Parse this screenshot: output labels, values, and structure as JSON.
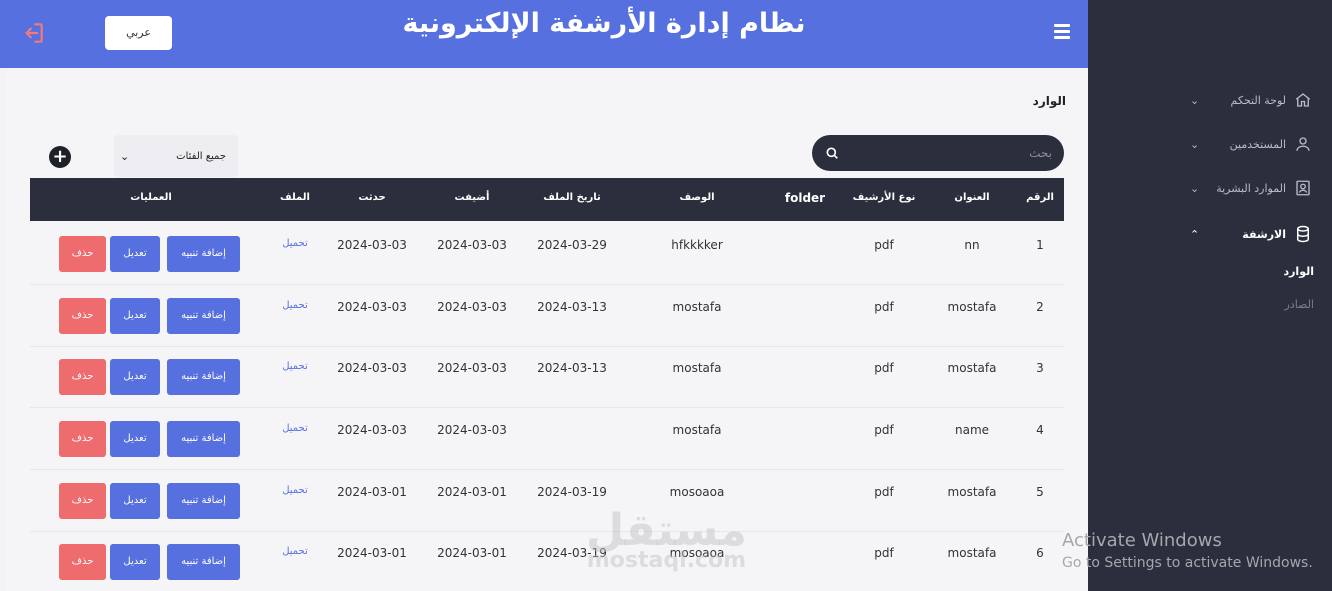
{
  "header": {
    "title": "نظام إدارة الأرشفة الإلكترونية",
    "lang_label": "عربي",
    "logout_icon": "logout-icon",
    "menu_icon": "hamburger-icon",
    "color": "#5670e0"
  },
  "sidebar": {
    "items": [
      {
        "label": "لوحة التحكم",
        "icon": "home-icon"
      },
      {
        "label": "المستخدمين",
        "icon": "user-icon"
      },
      {
        "label": "الموارد البشرية",
        "icon": "id-card-icon"
      },
      {
        "label": "الارشفة",
        "icon": "database-icon"
      }
    ],
    "subitems": [
      {
        "label": "الوارد"
      },
      {
        "label": "الصادر"
      }
    ],
    "bg_color": "#2b2e3c"
  },
  "main": {
    "page_title": "الوارد",
    "search_placeholder": "بحث",
    "category_select": "جميع الفئات",
    "add_icon": "plus-circle-icon"
  },
  "table": {
    "headers": [
      "الرقم",
      "العنوان",
      "نوع الأرشيف",
      "folder",
      "الوصف",
      "تاريخ الملف",
      "أضيفت",
      "حدثت",
      "الملف",
      "العمليات"
    ],
    "rows": [
      {
        "num": "1",
        "title": "nn",
        "type": "pdf",
        "folder": "",
        "desc": "hfkkkker",
        "file_date": "2024-03-29",
        "added": "2024-03-03",
        "updated": "2024-03-03",
        "file": "تحميل"
      },
      {
        "num": "2",
        "title": "mostafa",
        "type": "pdf",
        "folder": "",
        "desc": "mostafa",
        "file_date": "2024-03-13",
        "added": "2024-03-03",
        "updated": "2024-03-03",
        "file": "تحميل"
      },
      {
        "num": "3",
        "title": "mostafa",
        "type": "pdf",
        "folder": "",
        "desc": "mostafa",
        "file_date": "2024-03-13",
        "added": "2024-03-03",
        "updated": "2024-03-03",
        "file": "تحميل"
      },
      {
        "num": "4",
        "title": "name",
        "type": "pdf",
        "folder": "",
        "desc": "mostafa",
        "file_date": "",
        "added": "2024-03-03",
        "updated": "2024-03-03",
        "file": "تحميل"
      },
      {
        "num": "5",
        "title": "mostafa",
        "type": "pdf",
        "folder": "",
        "desc": "mosoaoa",
        "file_date": "2024-03-19",
        "added": "2024-03-01",
        "updated": "2024-03-01",
        "file": "تحميل"
      },
      {
        "num": "6",
        "title": "mostafa",
        "type": "pdf",
        "folder": "",
        "desc": "mosoaoa",
        "file_date": "2024-03-19",
        "added": "2024-03-01",
        "updated": "2024-03-01",
        "file": "تحميل"
      }
    ],
    "actions": {
      "add_alert": "إضافة تنبيه",
      "edit": "تعديل",
      "delete": "حذف"
    }
  },
  "overlay": {
    "watermark_ar": "مستقل",
    "watermark_en": "mostaql.com",
    "activate_title": "Activate Windows",
    "activate_sub": "Go to Settings to activate Windows."
  }
}
